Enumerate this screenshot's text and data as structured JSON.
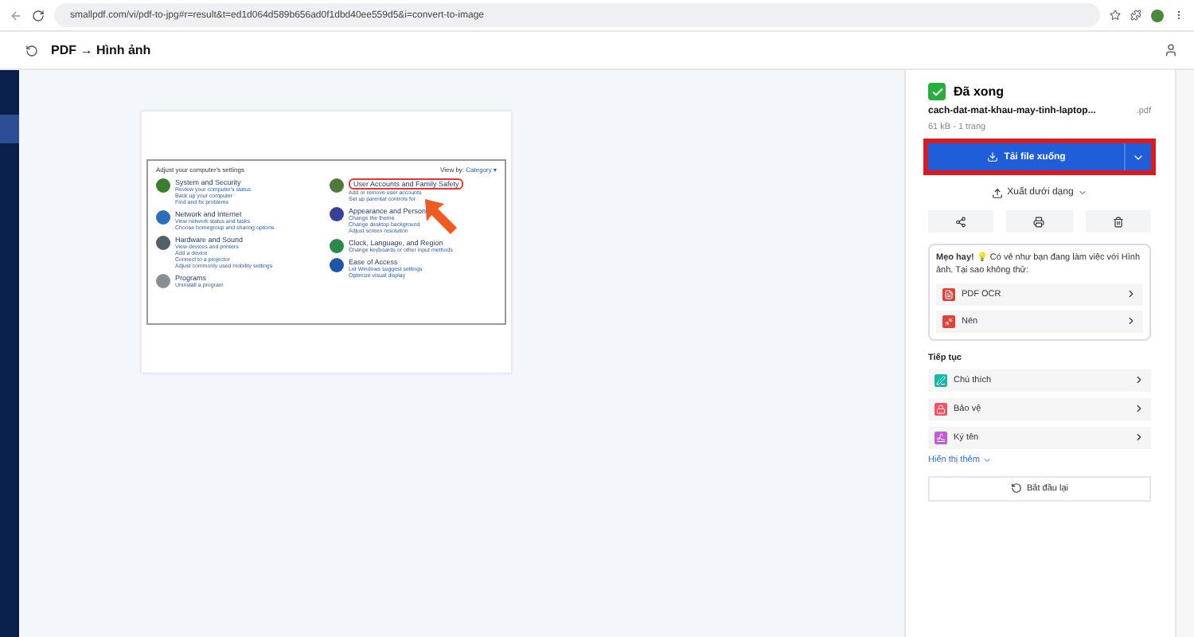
{
  "browser": {
    "url": "smallpdf.com/vi/pdf-to-jpg#r=result&t=ed1d064d589b656ad0f1dbd40ee559d5&i=convert-to-image"
  },
  "header": {
    "title": "PDF → Hình ảnh"
  },
  "preview": {
    "heading": "Adjust your computer's settings",
    "view_by_label": "View by:",
    "view_by_value": "Category ▾",
    "columns": [
      [
        {
          "title": "System and Security",
          "color": "#3a7d2c",
          "highlighted": false,
          "links": [
            "Review your computer's status",
            "Back up your computer",
            "Find and fix problems"
          ]
        },
        {
          "title": "Network and Internet",
          "color": "#2b6fb8",
          "highlighted": false,
          "links": [
            "View network status and tasks",
            "Choose homegroup and sharing options"
          ]
        },
        {
          "title": "Hardware and Sound",
          "color": "#555d66",
          "highlighted": false,
          "links": [
            "View devices and printers",
            "Add a device",
            "Connect to a projector",
            "Adjust commonly used mobility settings"
          ]
        },
        {
          "title": "Programs",
          "color": "#8a8f96",
          "highlighted": false,
          "links": [
            "Uninstall a program"
          ]
        }
      ],
      [
        {
          "title": "User Accounts and Family Safety",
          "color": "#4f7a3a",
          "highlighted": true,
          "links": [
            "Add or remove user accounts",
            "Set up parental controls for"
          ]
        },
        {
          "title": "Appearance and Person",
          "color": "#3b3f9a",
          "highlighted": false,
          "links": [
            "Change the theme",
            "Change desktop background",
            "Adjust screen resolution"
          ]
        },
        {
          "title": "Clock, Language, and Region",
          "color": "#2a8a4a",
          "highlighted": false,
          "links": [
            "Change keyboards or other input methods"
          ]
        },
        {
          "title": "Ease of Access",
          "color": "#1d56a8",
          "highlighted": false,
          "links": [
            "Let Windows suggest settings",
            "Optimize visual display"
          ]
        }
      ]
    ]
  },
  "file": {
    "status": "Đã xong",
    "name": "cach-dat-mat-khau-may-tinh-laptop...",
    "ext": ".pdf",
    "meta": "61 kB - 1 trang"
  },
  "download_button": {
    "label": "Tải file xuống",
    "highlighted": true
  },
  "export_button": {
    "label": "Xuất dưới dạng"
  },
  "tip": {
    "text": "**Mẹo hay!** 💡 Có vẻ như bạn đang làm việc với Hình ảnh. Tại sao không thử:",
    "items": [
      {
        "label": "PDF OCR",
        "kind": "ocr",
        "color": "#e0413b"
      },
      {
        "label": "Nén",
        "kind": "compress",
        "color": "#e0413b"
      }
    ]
  },
  "continue": {
    "heading": "Tiếp tục",
    "items": [
      {
        "label": "Chú thích",
        "kind": "annotate",
        "color": "#1fb5a8"
      },
      {
        "label": "Bảo vệ",
        "kind": "protect",
        "color": "#ef5366"
      },
      {
        "label": "Ký tên",
        "kind": "sign",
        "color": "#c45ad6"
      }
    ]
  },
  "show_more": "Hiển thị thêm",
  "restart": "Bắt đầu lại"
}
